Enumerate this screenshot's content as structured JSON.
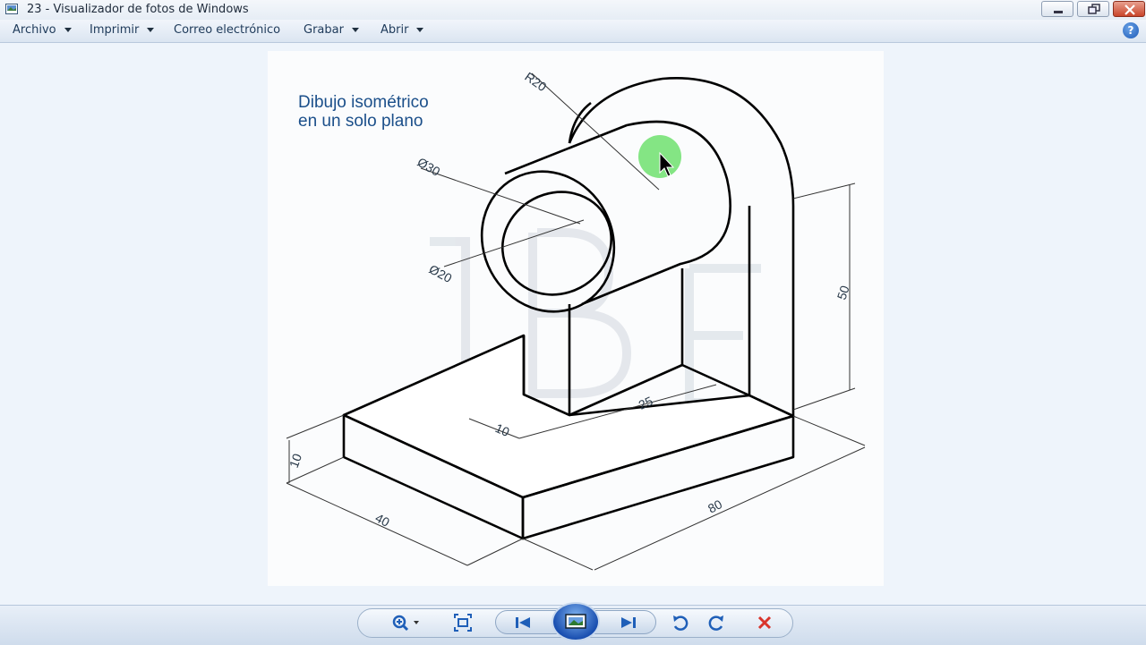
{
  "window": {
    "title": "23 - Visualizador de fotos de Windows"
  },
  "menu": {
    "items": [
      {
        "label": "Archivo",
        "has_dropdown": true
      },
      {
        "label": "Imprimir",
        "has_dropdown": true
      },
      {
        "label": "Correo electrónico",
        "has_dropdown": false
      },
      {
        "label": "Grabar",
        "has_dropdown": true
      },
      {
        "label": "Abrir",
        "has_dropdown": true
      }
    ],
    "help_glyph": "?"
  },
  "drawing": {
    "title": "Dibujo isométrico\nen un solo plano",
    "dimensions": {
      "r20": "R20",
      "d30": "Ø30",
      "d20": "Ø20",
      "d50": "50",
      "d10_rib": "10",
      "d25": "25",
      "d10_base": "10",
      "d40": "40",
      "d80": "80"
    }
  },
  "toolbar": {
    "icons": [
      "zoom-icon",
      "fit-window-icon",
      "previous-icon",
      "slideshow-icon",
      "next-icon",
      "rotate-left-icon",
      "rotate-right-icon",
      "delete-icon"
    ]
  },
  "colors": {
    "title_text": "#1b4f8a",
    "delete": "#d9342b",
    "nav_blue": "#1f5fb8",
    "cursor_highlight": "#6fe06f"
  }
}
